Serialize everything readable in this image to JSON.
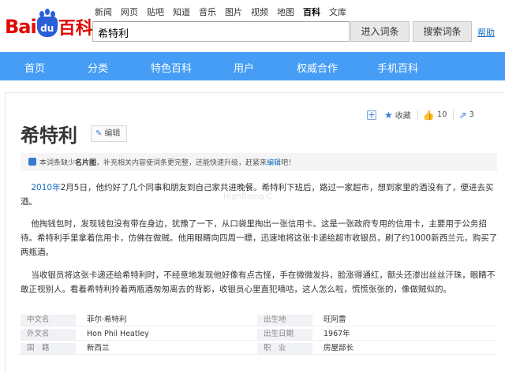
{
  "header": {
    "logo": {
      "part1": "Bai",
      "part2": "du",
      "part3": "百科"
    },
    "nav_links": [
      "新闻",
      "网页",
      "贴吧",
      "知道",
      "音乐",
      "图片",
      "视频",
      "地图",
      "百科",
      "文库"
    ],
    "active_nav": "百科",
    "search_value": "希特利",
    "enter_button": "进入词条",
    "search_button": "搜索词条",
    "help_link": "帮助"
  },
  "main_nav": {
    "items": [
      "首页",
      "分类",
      "特色百科",
      "用户",
      "权威合作",
      "手机百科"
    ]
  },
  "article": {
    "title": "希特利",
    "edit_label": "编辑",
    "actions": {
      "favorite_label": "收藏",
      "like_count": "10",
      "share_count": "3"
    },
    "notice": {
      "prefix": "本词条缺少",
      "bold": "名片图",
      "middle": "，补充相关内容使词条更完整，还能快速升级，赶紧来",
      "link": "编辑",
      "suffix": "吧！"
    },
    "watermark": "HighBoing.C",
    "paragraphs": {
      "p1_year": "2010年",
      "p1_rest": "2月5日，他约好了几个同事和朋友到自己家共进晚餐。希特利下班后，路过一家超市，想到家里的酒没有了，便进去买酒。",
      "p2": "他掏钱包时，发现钱包没有带在身边，犹豫了一下，从口袋里掏出一张信用卡。这是一张政府专用的信用卡，主要用于公务招待。希特利手里拿着信用卡，仿佛在做贼。他用眼睛向四周一瞟，迅速地将这张卡递给超市收银员，刷了约1000新西兰元，购买了两瓶酒。",
      "p3": "当收银员将这张卡递还给希特利时，不经意地发现他好像有点古怪，手在微微发抖，脸涨得通红，额头还渗出丝丝汗珠，眼睛不敢正视别人。看着希特利拎着两瓶酒匆匆离去的背影，收银员心里直犯嘀咕，这人怎么啦，慌慌张张的，像做贼似的。"
    },
    "info": [
      {
        "k1": "中文名",
        "v1": "菲尔·希特利",
        "k2": "出生地",
        "v2": "旺阿雷"
      },
      {
        "k1": "外文名",
        "v1": "Hon Phil Heatley",
        "k2": "出生日期",
        "v2": "1967年"
      },
      {
        "k1": "国　籍",
        "v1": "新西兰",
        "k2": "职　业",
        "v2": "房屋部长"
      }
    ]
  },
  "colors": {
    "brand_red": "#e10601",
    "brand_blue": "#2b5fd9",
    "nav_blue": "#459df5",
    "link_blue": "#136ec2"
  }
}
